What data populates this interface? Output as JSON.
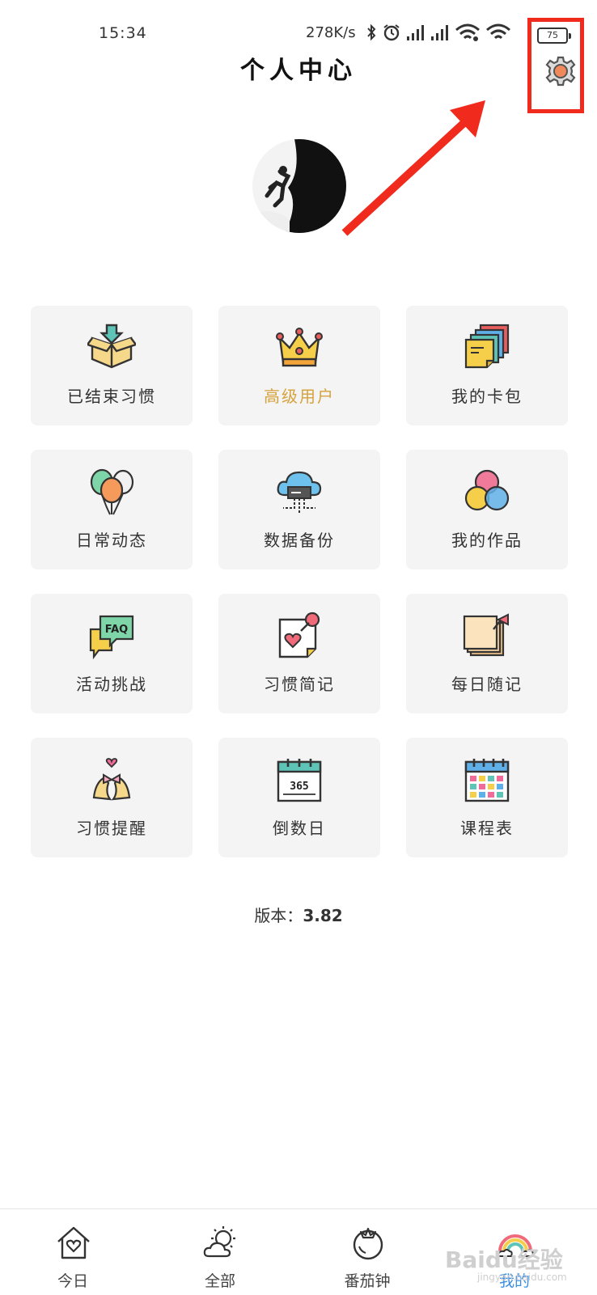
{
  "status": {
    "time": "15:34",
    "speed": "278K/s",
    "battery": "75"
  },
  "header": {
    "title": "个人中心"
  },
  "grid": [
    {
      "label": "已结束习惯",
      "icon": "box-download-icon"
    },
    {
      "label": "高级用户",
      "icon": "crown-icon"
    },
    {
      "label": "我的卡包",
      "icon": "cards-icon"
    },
    {
      "label": "日常动态",
      "icon": "balloons-icon"
    },
    {
      "label": "数据备份",
      "icon": "cloud-backup-icon"
    },
    {
      "label": "我的作品",
      "icon": "color-circles-icon"
    },
    {
      "label": "活动挑战",
      "icon": "faq-bubble-icon"
    },
    {
      "label": "习惯简记",
      "icon": "heart-note-icon"
    },
    {
      "label": "每日随记",
      "icon": "sticky-notes-icon"
    },
    {
      "label": "习惯提醒",
      "icon": "bells-icon"
    },
    {
      "label": "倒数日",
      "icon": "calendar-365-icon"
    },
    {
      "label": "课程表",
      "icon": "timetable-icon"
    }
  ],
  "version": {
    "label": "版本：",
    "value": "3.82"
  },
  "tabs": [
    {
      "label": "今日",
      "icon": "home-heart-icon"
    },
    {
      "label": "全部",
      "icon": "sun-cloud-icon"
    },
    {
      "label": "番茄钟",
      "icon": "tomato-icon"
    },
    {
      "label": "我的",
      "icon": "rainbow-icon",
      "active": true
    }
  ],
  "watermark": {
    "text": "Baidu经验",
    "sub": "jingyan.baidu.com"
  },
  "colors": {
    "accent": "#3b8fe3",
    "highlight": "#f02a1c",
    "gold": "#d5a23d",
    "tile_bg": "#f4f4f4"
  }
}
